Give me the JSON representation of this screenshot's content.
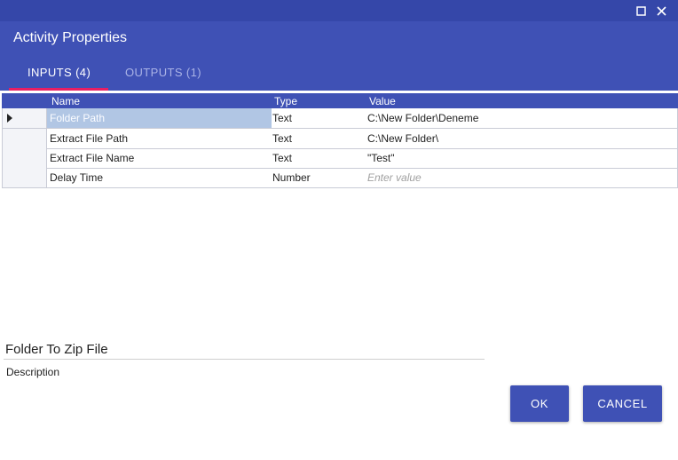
{
  "dialog": {
    "title": "Activity Properties",
    "window_buttons": {
      "maximize_icon": "maximize-icon",
      "close_icon": "close-icon"
    }
  },
  "tabs": [
    {
      "label": "INPUTS (4)",
      "active": true
    },
    {
      "label": "OUTPUTS (1)",
      "active": false
    }
  ],
  "grid": {
    "columns": [
      "Name",
      "Type",
      "Value"
    ],
    "rows": [
      {
        "name": "Folder Path",
        "type": "Text",
        "value": "C:\\New Folder\\Deneme",
        "selected": true
      },
      {
        "name": "Extract File Path",
        "type": "Text",
        "value": "C:\\New Folder\\"
      },
      {
        "name": "Extract File Name",
        "type": "Text",
        "value": "\"Test\""
      },
      {
        "name": "Delay Time",
        "type": "Number",
        "value": "",
        "placeholder": "Enter value"
      }
    ]
  },
  "activity": {
    "name": "Folder To Zip File",
    "description_label": "Description"
  },
  "buttons": {
    "ok": "OK",
    "cancel": "CANCEL"
  },
  "colors": {
    "header": "#3f51b5",
    "tab_indicator": "#e91e63",
    "selected_cell": "#b1c6e4"
  }
}
